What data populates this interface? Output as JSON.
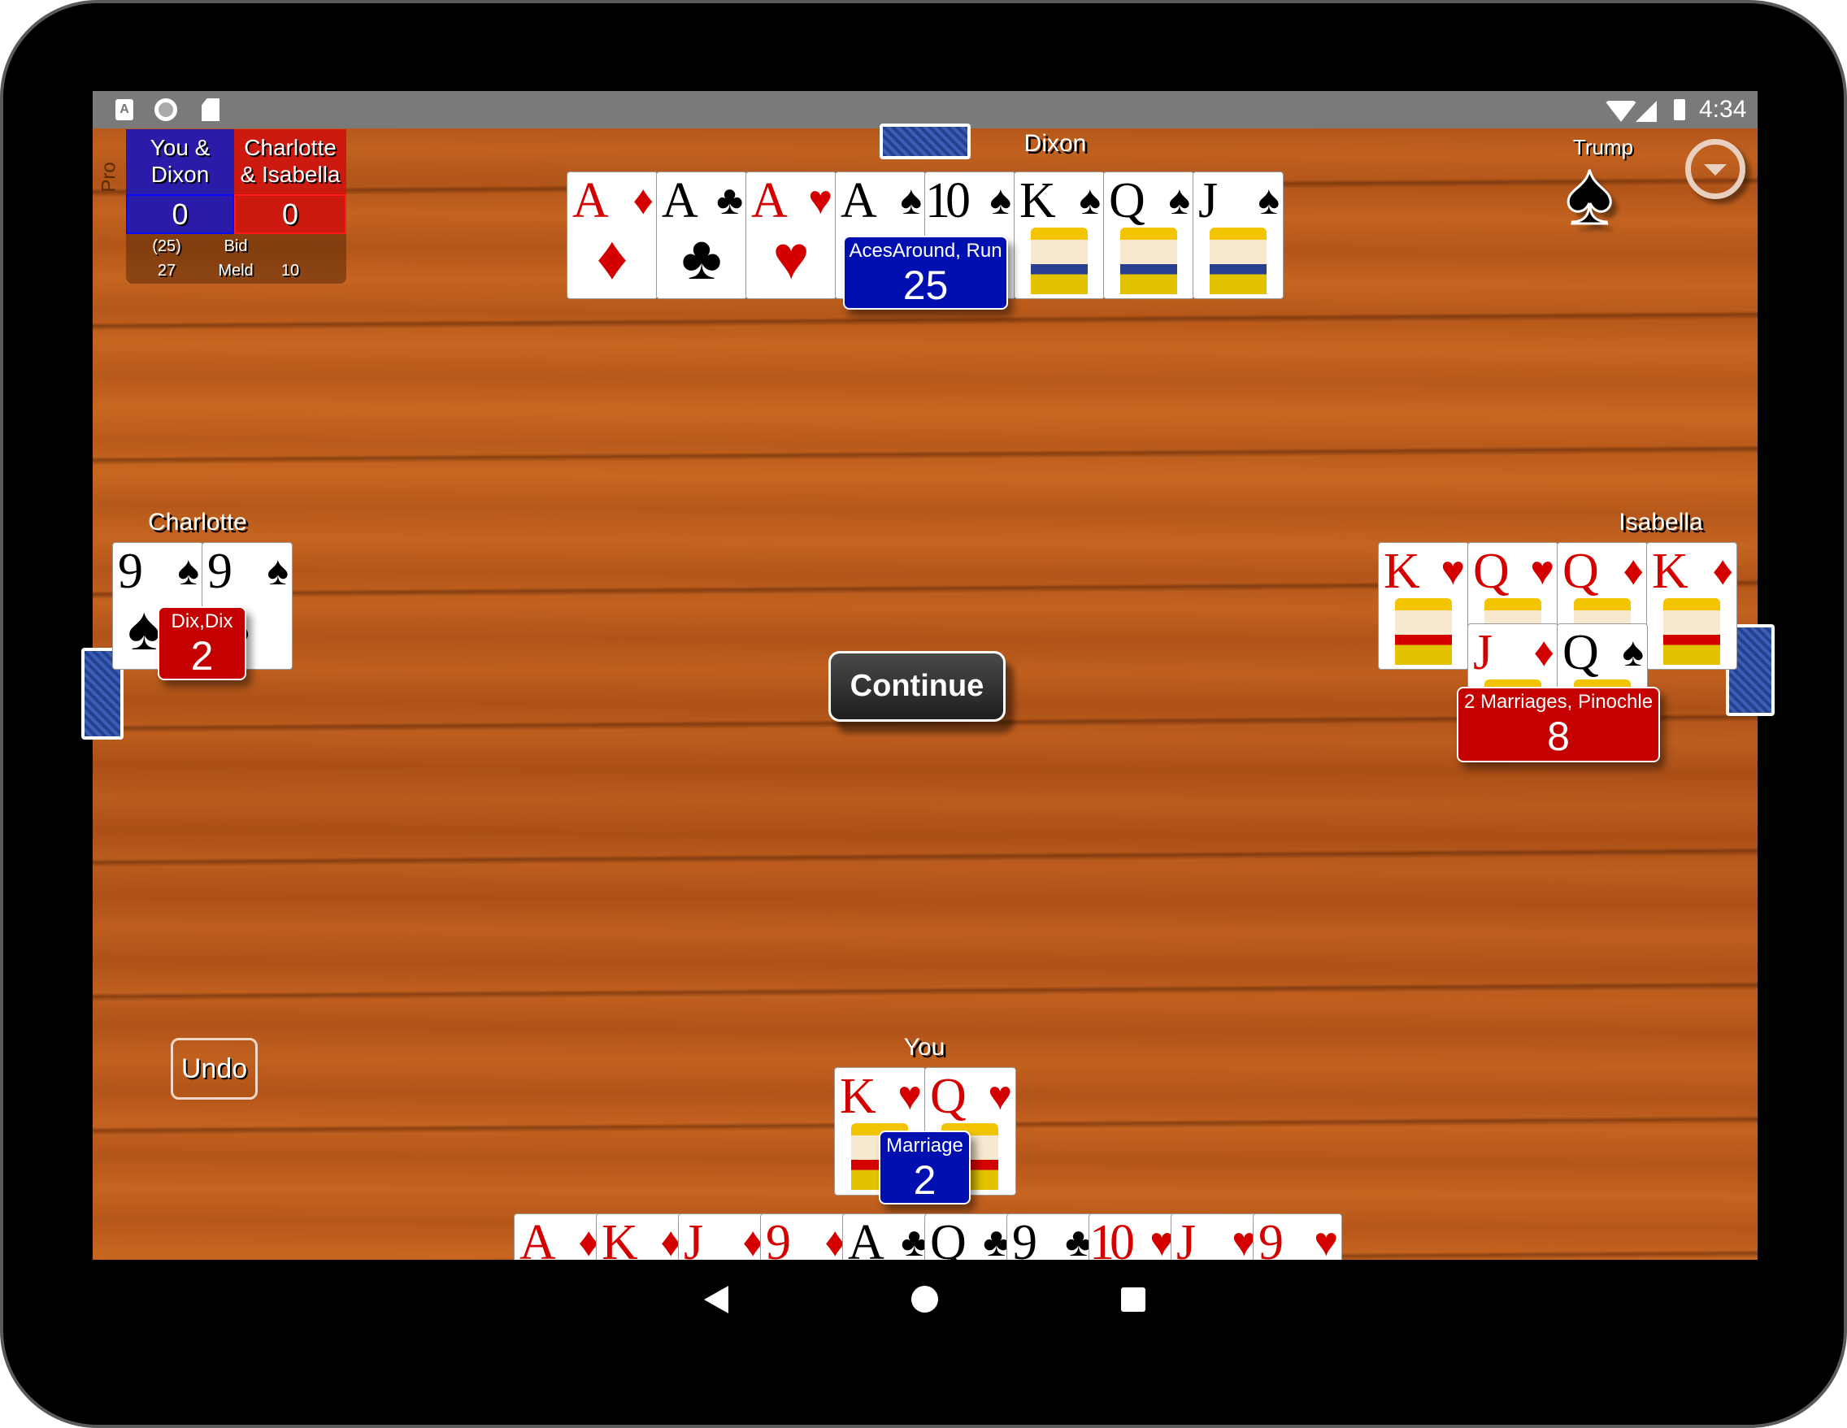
{
  "status_bar": {
    "time": "4:34",
    "left_icons": [
      "a-notification-icon",
      "record-icon",
      "sd-card-icon"
    ],
    "right_icons": [
      "wifi-icon",
      "signal-icon",
      "battery-charging-icon"
    ]
  },
  "scoreboard": {
    "mode": "Pro",
    "team_us": {
      "line1": "You &",
      "line2": "Dixon",
      "score": "0",
      "color": "#2a1ca8"
    },
    "team_them": {
      "line1": "Charlotte",
      "line2": "& Isabella",
      "score": "0",
      "color": "#cc1a10"
    },
    "bid_label": "Bid",
    "meld_label": "Meld",
    "bid_us": "(25)",
    "meld_us": "27",
    "meld_them": "10"
  },
  "trump": {
    "label": "Trump",
    "suit": "♠"
  },
  "players": {
    "dixon": {
      "name": "Dixon",
      "badge_color": "#0010b0",
      "meld_label": "AcesAround, Run",
      "meld_points": "25",
      "cards": [
        {
          "rank": "A",
          "suit": "♦"
        },
        {
          "rank": "A",
          "suit": "♣"
        },
        {
          "rank": "A",
          "suit": "♥"
        },
        {
          "rank": "A",
          "suit": "♠"
        },
        {
          "rank": "10",
          "suit": "♠"
        },
        {
          "rank": "K",
          "suit": "♠"
        },
        {
          "rank": "Q",
          "suit": "♠"
        },
        {
          "rank": "J",
          "suit": "♠"
        }
      ]
    },
    "charlotte": {
      "name": "Charlotte",
      "badge_color": "#c40000",
      "meld_label": "Dix,Dix",
      "meld_points": "2",
      "cards": [
        {
          "rank": "9",
          "suit": "♠"
        },
        {
          "rank": "9",
          "suit": "♠"
        }
      ]
    },
    "isabella": {
      "name": "Isabella",
      "badge_color": "#c40000",
      "meld_label": "2 Marriages, Pinochle",
      "meld_points": "8",
      "cards": [
        {
          "rank": "K",
          "suit": "♥"
        },
        {
          "rank": "Q",
          "suit": "♥"
        },
        {
          "rank": "Q",
          "suit": "♦"
        },
        {
          "rank": "K",
          "suit": "♦"
        },
        {
          "rank": "J",
          "suit": "♦"
        },
        {
          "rank": "Q",
          "suit": "♠"
        }
      ]
    },
    "you": {
      "name": "You",
      "badge_color": "#0010b0",
      "meld_label": "Marriage",
      "meld_points": "2",
      "cards": [
        {
          "rank": "K",
          "suit": "♥"
        },
        {
          "rank": "Q",
          "suit": "♥"
        }
      ]
    }
  },
  "hand": [
    {
      "rank": "A",
      "suit": "♦"
    },
    {
      "rank": "K",
      "suit": "♦"
    },
    {
      "rank": "J",
      "suit": "♦"
    },
    {
      "rank": "9",
      "suit": "♦"
    },
    {
      "rank": "A",
      "suit": "♣"
    },
    {
      "rank": "Q",
      "suit": "♣"
    },
    {
      "rank": "9",
      "suit": "♣"
    },
    {
      "rank": "10",
      "suit": "♥"
    },
    {
      "rank": "J",
      "suit": "♥"
    },
    {
      "rank": "9",
      "suit": "♥"
    }
  ],
  "buttons": {
    "continue": "Continue",
    "undo": "Undo"
  }
}
